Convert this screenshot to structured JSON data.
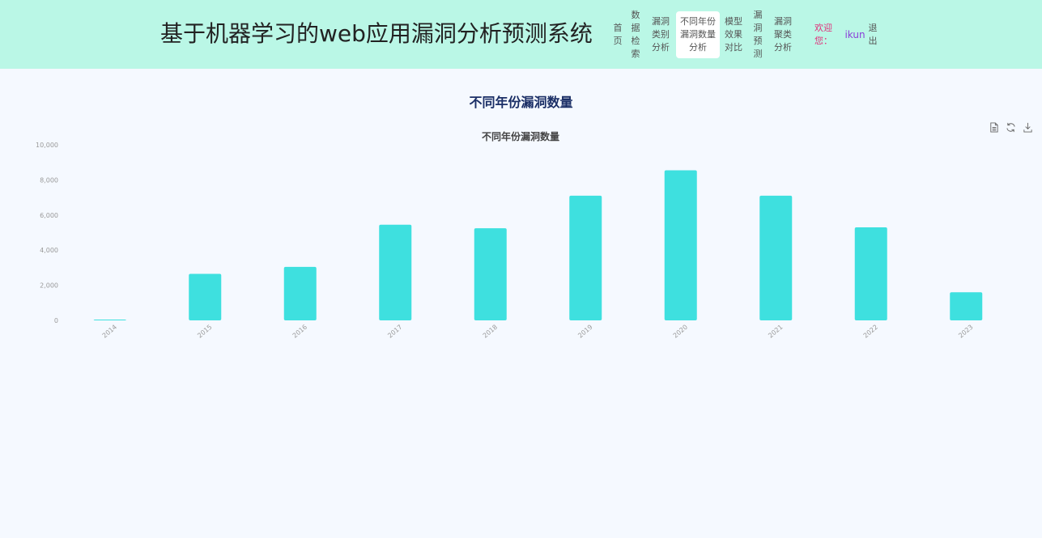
{
  "header": {
    "title": "基于机器学习的web应用漏洞分析预测系统",
    "nav": [
      {
        "key": "home",
        "lines": [
          "首",
          "页"
        ]
      },
      {
        "key": "data-search",
        "lines": [
          "数",
          "据",
          "检",
          "索"
        ]
      },
      {
        "key": "vuln-type",
        "lines": [
          "漏洞",
          "类别",
          "分析"
        ]
      },
      {
        "key": "vuln-year",
        "lines": [
          "不同年份",
          "漏洞数量",
          "分析"
        ],
        "active": true
      },
      {
        "key": "model-compare",
        "lines": [
          "模型",
          "效果",
          "对比"
        ]
      },
      {
        "key": "vuln-predict",
        "lines": [
          "漏",
          "洞",
          "预",
          "测"
        ]
      },
      {
        "key": "vuln-cluster",
        "lines": [
          "漏洞",
          "聚类",
          "分析"
        ]
      }
    ],
    "welcome_lines": [
      "欢迎",
      "您："
    ],
    "username": "ikun",
    "logout_lines": [
      "退",
      "出"
    ]
  },
  "page_heading": "不同年份漏洞数量",
  "toolbox": [
    "data-view-icon",
    "refresh-icon",
    "download-icon"
  ],
  "colors": {
    "header_bg": "#baf7e6",
    "bar": "#3ee0df",
    "heading": "#1b2f66"
  },
  "chart_data": {
    "type": "bar",
    "title": "不同年份漏洞数量",
    "categories": [
      "2014",
      "2015",
      "2016",
      "2017",
      "2018",
      "2019",
      "2020",
      "2021",
      "2022",
      "2023"
    ],
    "values": [
      40,
      2650,
      3050,
      5450,
      5250,
      7100,
      8550,
      7100,
      5300,
      1600
    ],
    "ylim": [
      0,
      10000
    ],
    "yticks": [
      "0",
      "2,000",
      "4,000",
      "6,000",
      "8,000",
      "10,000"
    ],
    "grid": false,
    "legend": "none"
  }
}
